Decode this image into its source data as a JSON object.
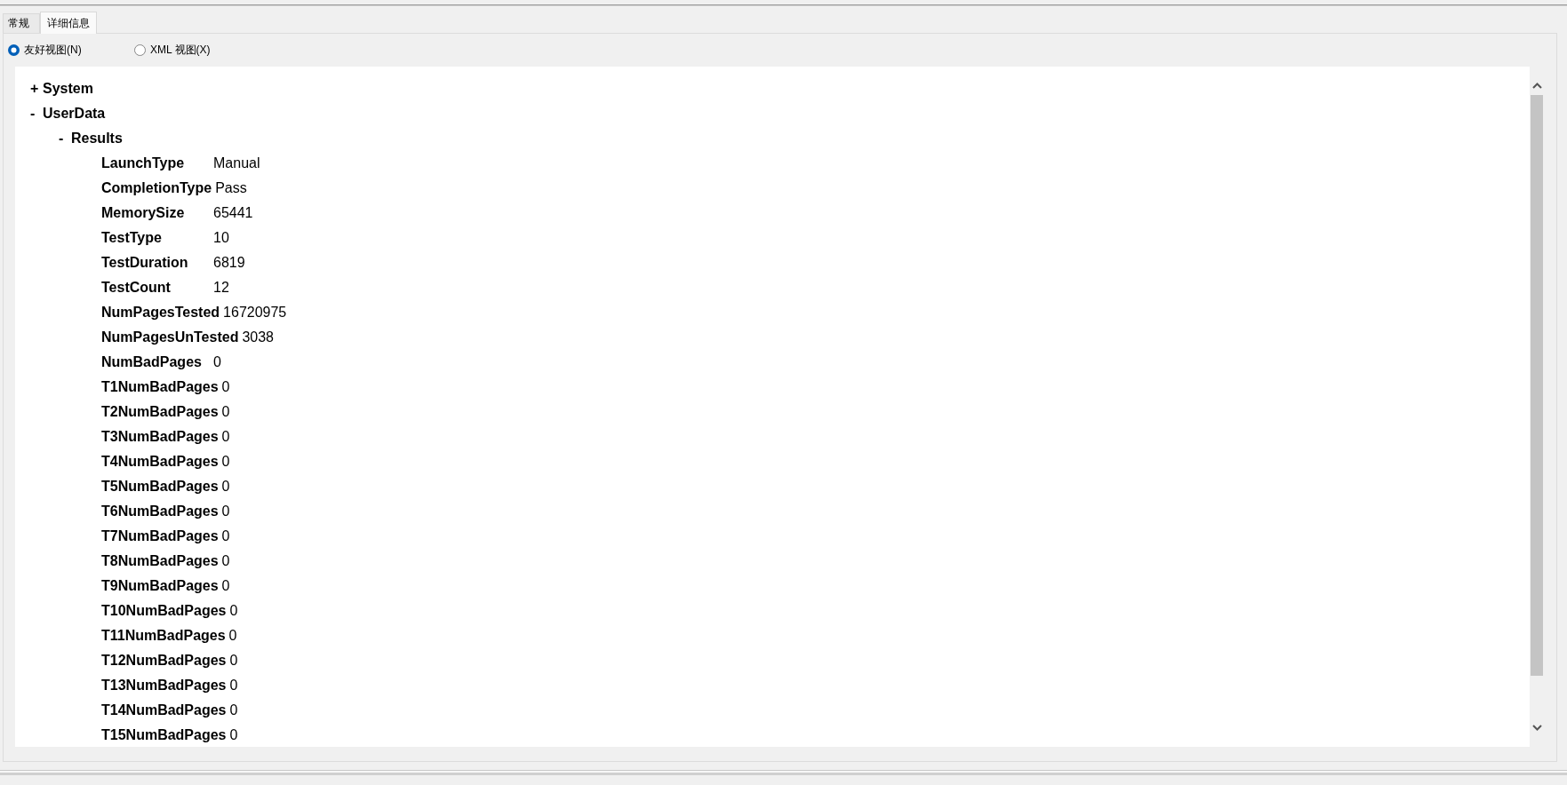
{
  "tabs": [
    {
      "label": "常规",
      "selected": false
    },
    {
      "label": "详细信息",
      "selected": true
    }
  ],
  "view_options": [
    {
      "label": "友好视图(N)",
      "selected": true
    },
    {
      "label": "XML 视图(X)",
      "selected": false
    }
  ],
  "tree": [
    {
      "toggle": "+",
      "label": "System"
    },
    {
      "toggle": "-",
      "label": "UserData",
      "children": [
        {
          "toggle": "-",
          "label": "Results",
          "children": [
            {
              "name": "LaunchType",
              "value": "Manual"
            },
            {
              "name": "CompletionType",
              "value": "Pass"
            },
            {
              "name": "MemorySize",
              "value": "65441"
            },
            {
              "name": "TestType",
              "value": "10"
            },
            {
              "name": "TestDuration",
              "value": "6819"
            },
            {
              "name": "TestCount",
              "value": "12"
            },
            {
              "name": "NumPagesTested",
              "value": "16720975"
            },
            {
              "name": "NumPagesUnTested",
              "value": "3038"
            },
            {
              "name": "NumBadPages",
              "value": "0"
            },
            {
              "name": "T1NumBadPages",
              "value": "0"
            },
            {
              "name": "T2NumBadPages",
              "value": "0"
            },
            {
              "name": "T3NumBadPages",
              "value": "0"
            },
            {
              "name": "T4NumBadPages",
              "value": "0"
            },
            {
              "name": "T5NumBadPages",
              "value": "0"
            },
            {
              "name": "T6NumBadPages",
              "value": "0"
            },
            {
              "name": "T7NumBadPages",
              "value": "0"
            },
            {
              "name": "T8NumBadPages",
              "value": "0"
            },
            {
              "name": "T9NumBadPages",
              "value": "0"
            },
            {
              "name": "T10NumBadPages",
              "value": "0"
            },
            {
              "name": "T11NumBadPages",
              "value": "0"
            },
            {
              "name": "T12NumBadPages",
              "value": "0"
            },
            {
              "name": "T13NumBadPages",
              "value": "0"
            },
            {
              "name": "T14NumBadPages",
              "value": "0"
            },
            {
              "name": "T15NumBadPages",
              "value": "0"
            }
          ]
        }
      ]
    }
  ]
}
